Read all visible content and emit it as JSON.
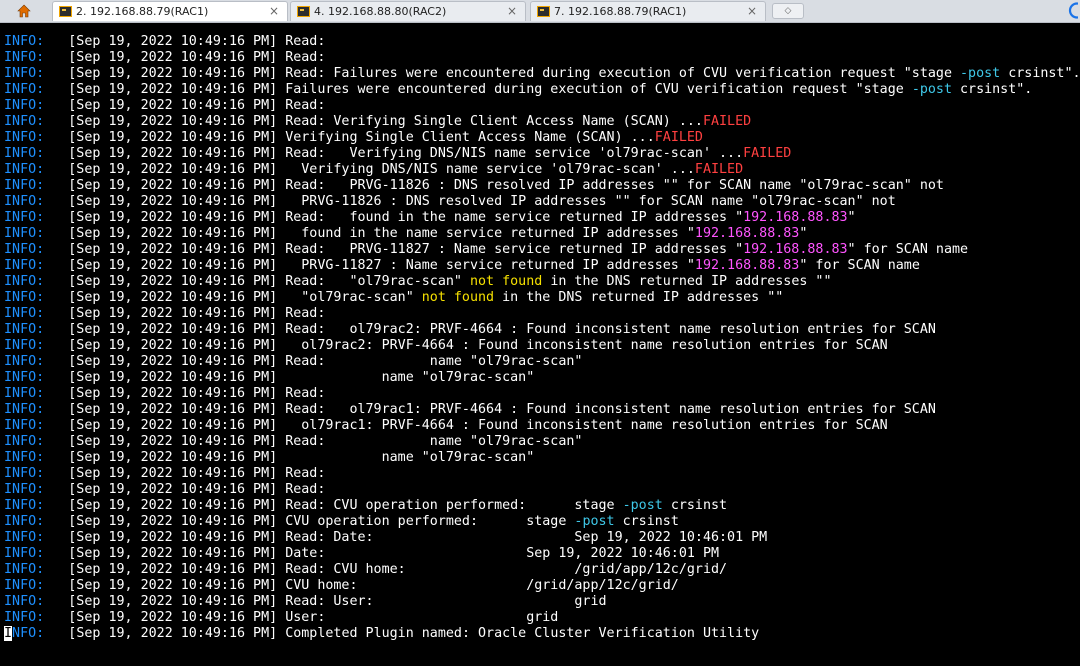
{
  "tabs": [
    {
      "label": "2. 192.168.88.79(RAC1)",
      "close": "×",
      "active": true
    },
    {
      "label": "4. 192.168.88.80(RAC2)",
      "close": "×",
      "active": false
    },
    {
      "label": "7. 192.168.88.79(RAC1)",
      "close": "×",
      "active": false
    }
  ],
  "new_tab_glyph": "◇",
  "colors": {
    "level": "#1e90ff",
    "failed": "#ff4040",
    "ip_address": "#ff55ff",
    "not_found": "#f5e000",
    "post_flag": "#3fc8e8",
    "background": "#000000",
    "text": "#ffffff"
  },
  "icons": {
    "home": "home-icon",
    "tab": "terminal-tab-icon",
    "browser": "edge-browser-icon"
  },
  "terminal": {
    "level": "INFO:",
    "timestamp": "[Sep 19, 2022 10:49:16 PM]",
    "lines": [
      [
        {
          "t": " Read:"
        }
      ],
      [
        {
          "t": " Read:"
        }
      ],
      [
        {
          "t": " Read: Failures were encountered during execution of CVU verification request \"stage "
        },
        {
          "t": "-post",
          "c": "cyn"
        },
        {
          "t": " crsinst\"."
        }
      ],
      [
        {
          "t": " Failures were encountered during execution of CVU verification request \"stage "
        },
        {
          "t": "-post",
          "c": "cyn"
        },
        {
          "t": " crsinst\"."
        }
      ],
      [
        {
          "t": " Read:"
        }
      ],
      [
        {
          "t": " Read: Verifying Single Client Access Name (SCAN) ..."
        },
        {
          "t": "FAILED",
          "c": "red"
        }
      ],
      [
        {
          "t": " Verifying Single Client Access Name (SCAN) ..."
        },
        {
          "t": "FAILED",
          "c": "red"
        }
      ],
      [
        {
          "t": " Read:   Verifying DNS/NIS name service 'ol79rac-scan' ..."
        },
        {
          "t": "FAILED",
          "c": "red"
        }
      ],
      [
        {
          "t": "   Verifying DNS/NIS name service 'ol79rac-scan' ..."
        },
        {
          "t": "FAILED",
          "c": "red"
        }
      ],
      [
        {
          "t": " Read:   PRVG-11826 : DNS resolved IP addresses \"\" for SCAN name \"ol79rac-scan\" not"
        }
      ],
      [
        {
          "t": "   PRVG-11826 : DNS resolved IP addresses \"\" for SCAN name \"ol79rac-scan\" not"
        }
      ],
      [
        {
          "t": " Read:   found in the name service returned IP addresses \""
        },
        {
          "t": "192.168.88.83",
          "c": "mag"
        },
        {
          "t": "\""
        }
      ],
      [
        {
          "t": "   found in the name service returned IP addresses \""
        },
        {
          "t": "192.168.88.83",
          "c": "mag"
        },
        {
          "t": "\""
        }
      ],
      [
        {
          "t": " Read:   PRVG-11827 : Name service returned IP addresses \""
        },
        {
          "t": "192.168.88.83",
          "c": "mag"
        },
        {
          "t": "\" for SCAN name"
        }
      ],
      [
        {
          "t": "   PRVG-11827 : Name service returned IP addresses \""
        },
        {
          "t": "192.168.88.83",
          "c": "mag"
        },
        {
          "t": "\" for SCAN name"
        }
      ],
      [
        {
          "t": " Read:   \"ol79rac-scan\" "
        },
        {
          "t": "not found",
          "c": "yel"
        },
        {
          "t": " in the DNS returned IP addresses \"\""
        }
      ],
      [
        {
          "t": "   \"ol79rac-scan\" "
        },
        {
          "t": "not found",
          "c": "yel"
        },
        {
          "t": " in the DNS returned IP addresses \"\""
        }
      ],
      [
        {
          "t": " Read:"
        }
      ],
      [
        {
          "t": " Read:   ol79rac2: PRVF-4664 : Found inconsistent name resolution entries for SCAN"
        }
      ],
      [
        {
          "t": "   ol79rac2: PRVF-4664 : Found inconsistent name resolution entries for SCAN"
        }
      ],
      [
        {
          "t": " Read:             name \"ol79rac-scan\""
        }
      ],
      [
        {
          "t": "             name \"ol79rac-scan\""
        }
      ],
      [
        {
          "t": " Read:"
        }
      ],
      [
        {
          "t": " Read:   ol79rac1: PRVF-4664 : Found inconsistent name resolution entries for SCAN"
        }
      ],
      [
        {
          "t": "   ol79rac1: PRVF-4664 : Found inconsistent name resolution entries for SCAN"
        }
      ],
      [
        {
          "t": " Read:             name \"ol79rac-scan\""
        }
      ],
      [
        {
          "t": "             name \"ol79rac-scan\""
        }
      ],
      [
        {
          "t": " Read:"
        }
      ],
      [
        {
          "t": " Read:"
        }
      ],
      [
        {
          "t": " Read: CVU operation performed:      stage "
        },
        {
          "t": "-post",
          "c": "cyn"
        },
        {
          "t": " crsinst"
        }
      ],
      [
        {
          "t": " CVU operation performed:      stage "
        },
        {
          "t": "-post",
          "c": "cyn"
        },
        {
          "t": " crsinst"
        }
      ],
      [
        {
          "t": " Read: Date:                         Sep 19, 2022 10:46:01 PM"
        }
      ],
      [
        {
          "t": " Date:                         Sep 19, 2022 10:46:01 PM"
        }
      ],
      [
        {
          "t": " Read: CVU home:                     /grid/app/12c/grid/"
        }
      ],
      [
        {
          "t": " CVU home:                     /grid/app/12c/grid/"
        }
      ],
      [
        {
          "t": " Read: User:                         grid"
        }
      ],
      [
        {
          "t": " User:                         grid"
        }
      ],
      [
        {
          "t": " Completed Plugin named: Oracle Cluster Verification Utility"
        }
      ]
    ]
  }
}
